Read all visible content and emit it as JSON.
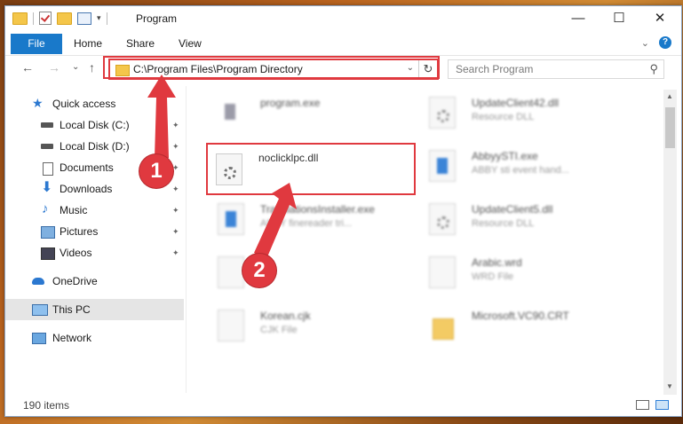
{
  "window": {
    "title": "Program",
    "minimize": "—",
    "maximize": "☐",
    "close": "✕"
  },
  "ribbon": {
    "tabs": [
      "File",
      "Home",
      "Share",
      "View"
    ],
    "help": "?"
  },
  "navbar": {
    "back": "←",
    "forward": "→",
    "recent": "⌄",
    "up": "↑",
    "address": "C:\\Program Files\\Program Directory",
    "address_dropdown": "⌄",
    "refresh": "↻",
    "search_placeholder": "Search Program",
    "search_glyph": "⚲"
  },
  "sidebar": {
    "items": [
      {
        "label": "Quick access",
        "icon": "star-icon",
        "color": "#2b78d0"
      },
      {
        "label": "Local Disk (C:)",
        "icon": "drive-icon",
        "pinned": true
      },
      {
        "label": "Local Disk (D:)",
        "icon": "drive-icon",
        "pinned": true
      },
      {
        "label": "Documents",
        "icon": "documents-icon",
        "pinned": true
      },
      {
        "label": "Downloads",
        "icon": "downloads-icon",
        "pinned": true
      },
      {
        "label": "Music",
        "icon": "music-icon",
        "pinned": true
      },
      {
        "label": "Pictures",
        "icon": "pictures-icon",
        "pinned": true
      },
      {
        "label": "Videos",
        "icon": "videos-icon",
        "pinned": true
      },
      {
        "label": "OneDrive",
        "icon": "onedrive-icon"
      },
      {
        "label": "This PC",
        "icon": "computer-icon",
        "selected": true
      },
      {
        "label": "Network",
        "icon": "network-icon"
      }
    ],
    "pin_glyph": "📌"
  },
  "files": [
    {
      "name": "program.exe",
      "sub": "",
      "icon": "exe-icon"
    },
    {
      "name": "UpdateClient42.dll",
      "sub": "Resource DLL",
      "icon": "dll-icon"
    },
    {
      "name": "noclicklpc.dll",
      "sub": "",
      "icon": "dll-gear-icon",
      "highlighted": true
    },
    {
      "name": "AbbyySTI.exe",
      "sub": "ABBY sti event hand...",
      "icon": "app-icon"
    },
    {
      "name": "TranslationsInstaller.exe",
      "sub": "ABBY finereader tri...",
      "icon": "app-icon"
    },
    {
      "name": "UpdateClient5.dll",
      "sub": "Resource DLL",
      "icon": "dll-icon"
    },
    {
      "name": "",
      "sub": "",
      "icon": "blank-file-icon"
    },
    {
      "name": "Arabic.wrd",
      "sub": "WRD File",
      "icon": "blank-file-icon"
    },
    {
      "name": "Korean.cjk",
      "sub": "CJK File",
      "icon": "blank-file-icon"
    },
    {
      "name": "Microsoft.VC90.CRT",
      "sub": "",
      "icon": "folder-icon"
    }
  ],
  "annotations": {
    "step1": "1",
    "step2": "2",
    "color": "#e0393f"
  },
  "status": {
    "count": "190 items"
  }
}
